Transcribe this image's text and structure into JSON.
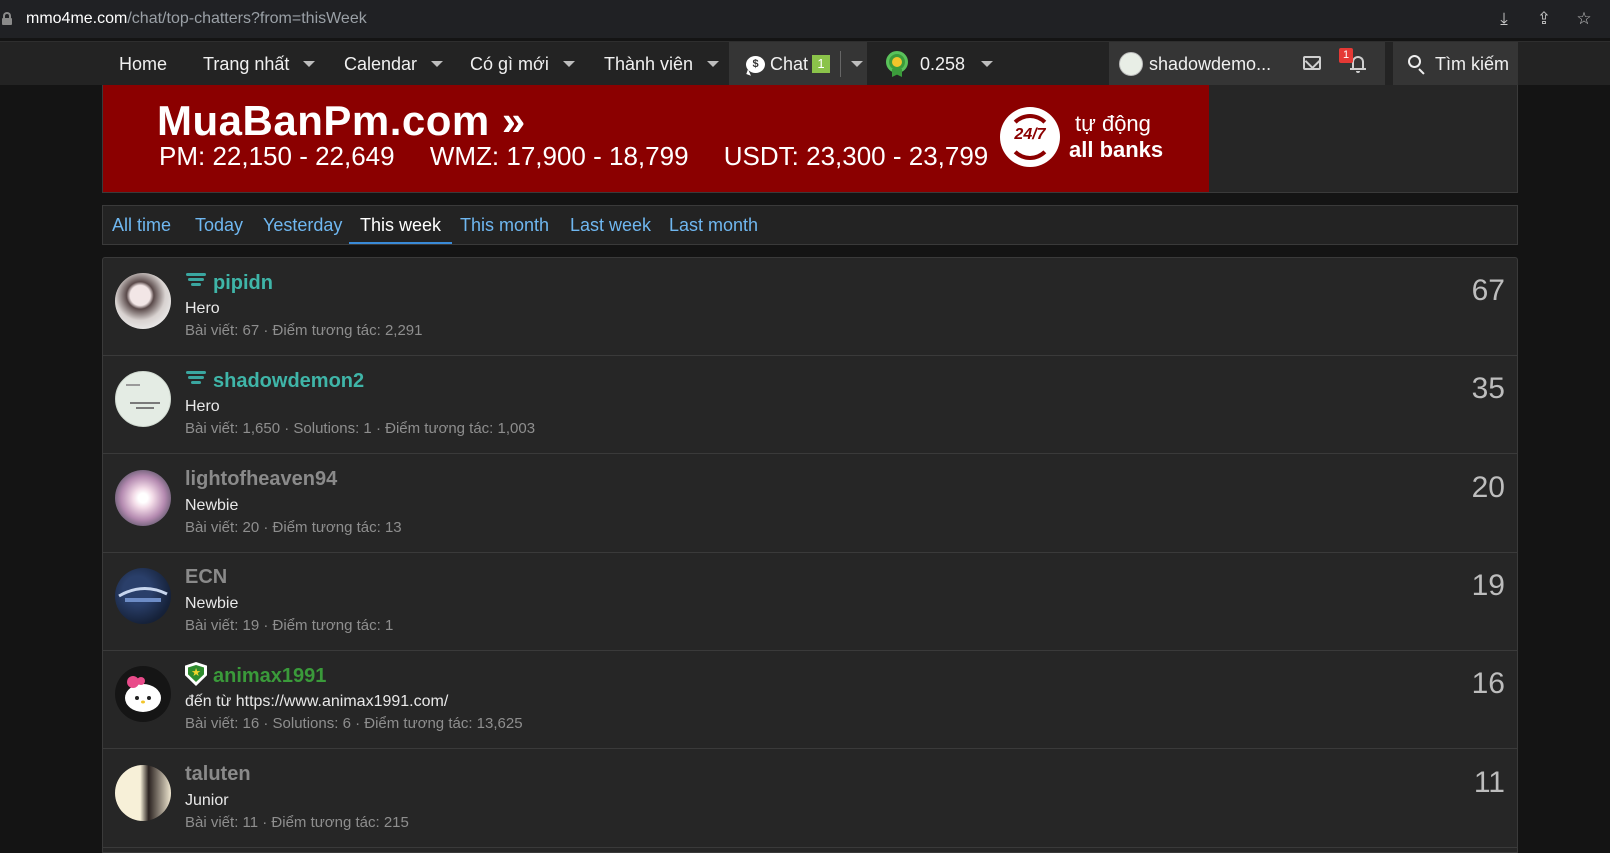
{
  "browser": {
    "url_host": "mmo4me.com",
    "url_path": "/chat/top-chatters?from=thisWeek",
    "icons": [
      "install-icon",
      "share-icon",
      "star-icon"
    ]
  },
  "nav": {
    "home": "Home",
    "trang_nhat": "Trang nhất",
    "calendar": "Calendar",
    "co_gi_moi": "Có gì mới",
    "thanh_vien": "Thành viên",
    "chat": "Chat",
    "chat_badge": "1",
    "balance": "0.258",
    "username": "shadowdemo...",
    "notif_count": "1",
    "search": "Tìm kiếm"
  },
  "banner": {
    "title": "MuaBanPm.com »",
    "rates": [
      "PM: 22,150 - 22,649",
      "WMZ: 17,900 - 18,799",
      "USDT: 23,300 - 23,799"
    ],
    "badge": "24/7",
    "line1": "tự động",
    "line2": "all banks"
  },
  "tabs": [
    {
      "label": "All time"
    },
    {
      "label": "Today"
    },
    {
      "label": "Yesterday"
    },
    {
      "label": "This week",
      "active": true
    },
    {
      "label": "This month"
    },
    {
      "label": "Last week"
    },
    {
      "label": "Last month"
    }
  ],
  "chatters": [
    {
      "name": "pipidn",
      "title": "Hero",
      "stats": "Bài viết: 67 · Điểm tương tác: 2,291",
      "count": "67",
      "name_color": "#3fb5a8",
      "rank_icon": "wing-icon"
    },
    {
      "name": "shadowdemon2",
      "title": "Hero",
      "stats": "Bài viết: 1,650 · Solutions: 1 · Điểm tương tác: 1,003",
      "count": "35",
      "name_color": "#3fb5a8",
      "rank_icon": "wing-icon"
    },
    {
      "name": "lightofheaven94",
      "title": "Newbie",
      "stats": "Bài viết: 20 · Điểm tương tác: 13",
      "count": "20",
      "name_color": "#8a8a8a",
      "rank_icon": ""
    },
    {
      "name": "ECN",
      "title": "Newbie",
      "stats": "Bài viết: 19 · Điểm tương tác: 1",
      "count": "19",
      "name_color": "#8a8a8a",
      "rank_icon": ""
    },
    {
      "name": "animax1991",
      "title": "đến từ https://www.animax1991.com/",
      "stats": "Bài viết: 16 · Solutions: 6 · Điểm tương tác: 13,625",
      "count": "16",
      "name_color": "#3a9a3a",
      "rank_icon": "shield-icon"
    },
    {
      "name": "taluten",
      "title": "Junior",
      "stats": "Bài viết: 11 · Điểm tương tác: 215",
      "count": "11",
      "name_color": "#8a8a8a",
      "rank_icon": ""
    }
  ]
}
